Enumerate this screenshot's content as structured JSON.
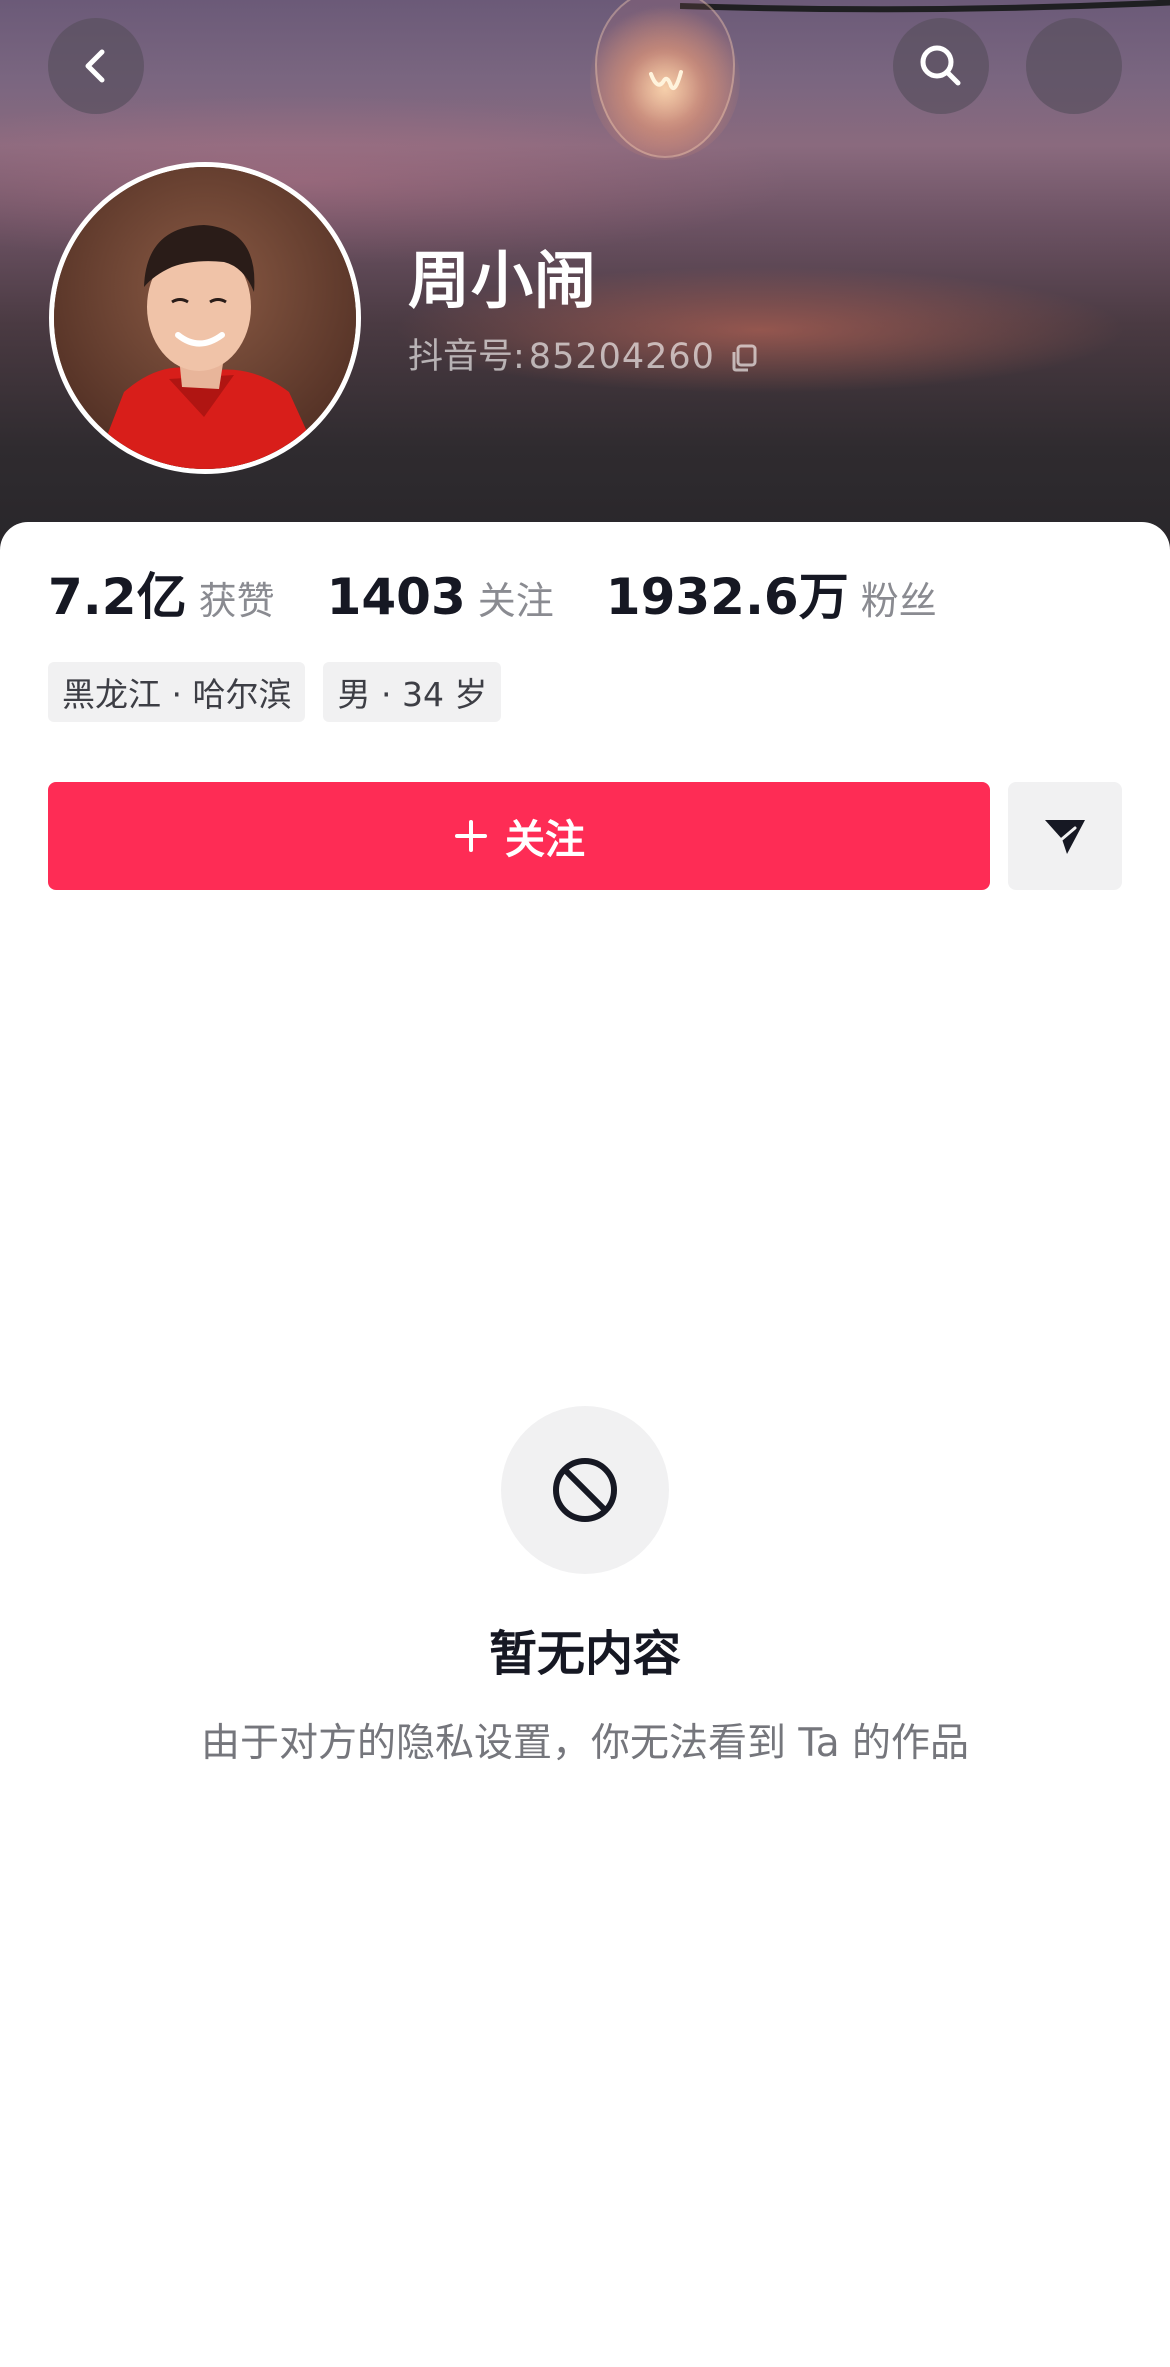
{
  "header": {
    "back_icon": "chevron-left-icon",
    "search_icon": "search-icon",
    "more_icon": "more-icon"
  },
  "profile": {
    "name": "周小闹",
    "id_label": "抖音号:",
    "id_value": "85204260",
    "copy_icon": "copy-icon"
  },
  "stats": [
    {
      "value": "7.2亿",
      "label": "获赞"
    },
    {
      "value": "1403",
      "label": "关注"
    },
    {
      "value": "1932.6万",
      "label": "粉丝"
    }
  ],
  "tags": [
    "黑龙江 · 哈尔滨",
    "男 · 34 岁"
  ],
  "actions": {
    "follow_label": "关注",
    "follow_icon": "plus-icon",
    "share_icon": "send-icon"
  },
  "empty_state": {
    "icon": "prohibited-icon",
    "title": "暂无内容",
    "description": "由于对方的隐私设置，你无法看到 Ta 的作品"
  },
  "colors": {
    "accent": "#fe2c55",
    "text_primary": "#161823",
    "text_secondary": "#8a8b91",
    "tag_bg": "#f1f1f2"
  }
}
